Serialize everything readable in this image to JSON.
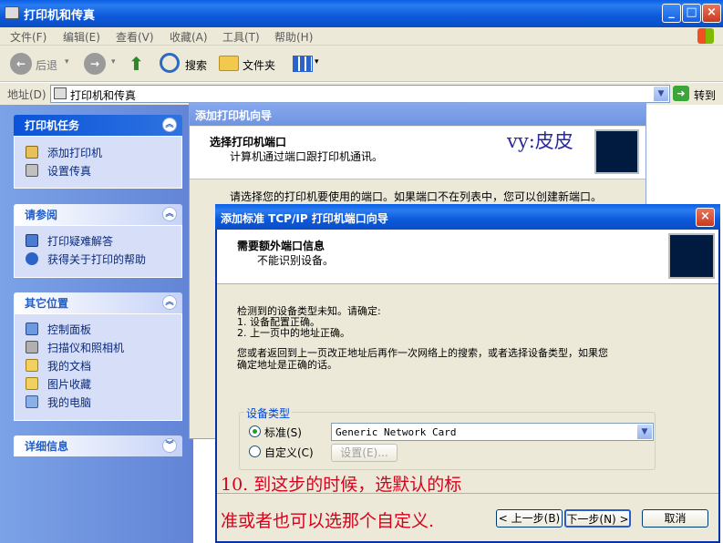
{
  "window": {
    "title": "打印机和传真"
  },
  "menu": {
    "items": [
      "文件(F)",
      "编辑(E)",
      "查看(V)",
      "收藏(A)",
      "工具(T)",
      "帮助(H)"
    ]
  },
  "toolbar": {
    "back": "后退",
    "search": "搜索",
    "folders": "文件夹"
  },
  "address": {
    "label": "地址(D)",
    "value": "打印机和传真",
    "go": "转到"
  },
  "sidebar": {
    "tasks": {
      "title": "打印机任务",
      "items": [
        "添加打印机",
        "设置传真"
      ]
    },
    "see_also": {
      "title": "请参阅",
      "items": [
        "打印疑难解答",
        "获得关于打印的帮助"
      ]
    },
    "other": {
      "title": "其它位置",
      "items": [
        "控制面板",
        "扫描仪和照相机",
        "我的文档",
        "图片收藏",
        "我的电脑"
      ]
    },
    "details": {
      "title": "详细信息"
    }
  },
  "wizard1": {
    "title": "添加打印机向导",
    "heading": "选择打印机端口",
    "subheading": "计算机通过端口跟打印机通讯。",
    "watermark": "vy:皮皮",
    "body": "请选择您的打印机要使用的端口。如果端口不在列表中，您可以创建新端口。"
  },
  "wizard2": {
    "title": "添加标准 TCP/IP 打印机端口向导",
    "heading": "需要额外端口信息",
    "subheading": "不能识别设备。",
    "line1": "检测到的设备类型未知。请确定:",
    "line2": "1. 设备配置正确。",
    "line3": "2. 上一页中的地址正确。",
    "line4": "您或者返回到上一页改正地址后再作一次网络上的搜索，或者选择设备类型，如果您",
    "line5": "确定地址是正确的话。",
    "group_label": "设备类型",
    "radio_standard": "标准(S)",
    "radio_custom": "自定义(C)",
    "select_value": "Generic Network Card",
    "settings_btn": "设置(E)...",
    "back_btn": "< 上一步(B)",
    "next_btn": "下一步(N) >",
    "cancel_btn": "取消"
  },
  "annotation": {
    "line1": "10. 到这步的时候，选默认的标",
    "line2": "准或者也可以选那个自定义."
  }
}
